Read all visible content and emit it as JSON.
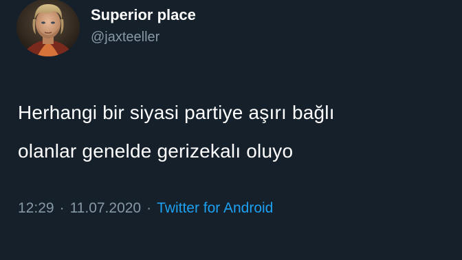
{
  "tweet": {
    "author": {
      "display_name": "Superior place",
      "handle": "@jaxteeller"
    },
    "text_lines": [
      "Herhangi bir siyasi partiye aşırı bağlı",
      "olanlar genelde gerizekalı oluyo"
    ],
    "time": "12:29",
    "separator": "·",
    "date": "11.07.2020",
    "source": "Twitter for Android"
  },
  "colors": {
    "background": "#15202b",
    "text_primary": "#ffffff",
    "text_secondary": "#8899a6",
    "link": "#1da1f2"
  },
  "icons": {
    "avatar": "profile-photo"
  }
}
